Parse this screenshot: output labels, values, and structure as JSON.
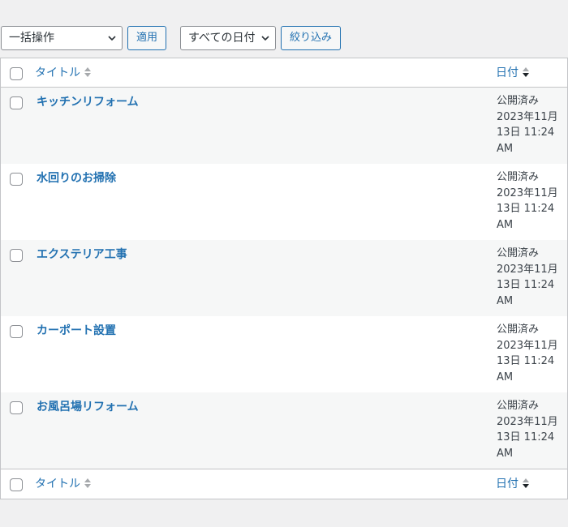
{
  "toolbar": {
    "bulk_action": "一括操作",
    "apply": "適用",
    "date_filter": "すべての日付",
    "filter": "絞り込み"
  },
  "columns": {
    "title": "タイトル",
    "date": "日付"
  },
  "rows": [
    {
      "title": "キッチンリフォーム",
      "status": "公開済み",
      "date_line1": "2023年11月",
      "date_line2": "13日 11:24",
      "date_line3": "AM"
    },
    {
      "title": "水回りのお掃除",
      "status": "公開済み",
      "date_line1": "2023年11月",
      "date_line2": "13日 11:24",
      "date_line3": "AM"
    },
    {
      "title": "エクステリア工事",
      "status": "公開済み",
      "date_line1": "2023年11月",
      "date_line2": "13日 11:24",
      "date_line3": "AM"
    },
    {
      "title": "カーポート設置",
      "status": "公開済み",
      "date_line1": "2023年11月",
      "date_line2": "13日 11:24",
      "date_line3": "AM"
    },
    {
      "title": "お風呂場リフォーム",
      "status": "公開済み",
      "date_line1": "2023年11月",
      "date_line2": "13日 11:24",
      "date_line3": "AM"
    }
  ],
  "colors": {
    "link": "#2271b1",
    "row_alt": "#f6f7f7",
    "border": "#c3c4c7",
    "background": "#f0f0f1"
  }
}
